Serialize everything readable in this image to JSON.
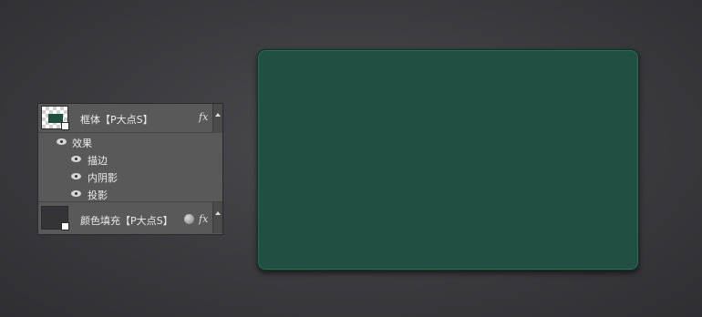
{
  "layers_panel": {
    "shape_layer": {
      "name": "框体【P大点S】",
      "fx": "fx",
      "effects_header": "效果",
      "effects": [
        {
          "label": "描边"
        },
        {
          "label": "内阴影"
        },
        {
          "label": "投影"
        }
      ]
    },
    "fill_layer": {
      "name": "颜色填充【P大点S】",
      "fx": "fx"
    }
  },
  "canvas": {
    "card_color": "#214f42",
    "background_color": "#3a3a3f"
  }
}
